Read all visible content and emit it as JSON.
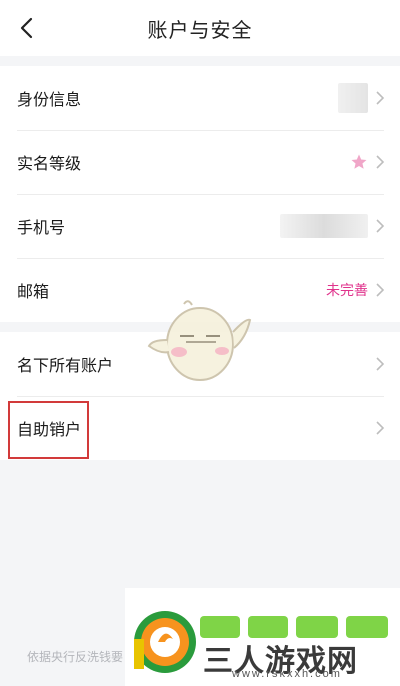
{
  "header": {
    "title": "账户与安全"
  },
  "group1": {
    "items": [
      {
        "label": "身份信息"
      },
      {
        "label": "实名等级"
      },
      {
        "label": "手机号"
      },
      {
        "label": "邮箱",
        "status": "未完善"
      }
    ]
  },
  "group2": {
    "items": [
      {
        "label": "名下所有账户"
      },
      {
        "label": "自助销户"
      }
    ]
  },
  "footer": {
    "note": "依据央行反洗钱要"
  },
  "watermark": {
    "title": "三人游戏网",
    "url": "www.rskxxh.com"
  },
  "colors": {
    "accent": "#e0338c",
    "highlight": "#d23a3a",
    "star": "#f0a6c8"
  }
}
